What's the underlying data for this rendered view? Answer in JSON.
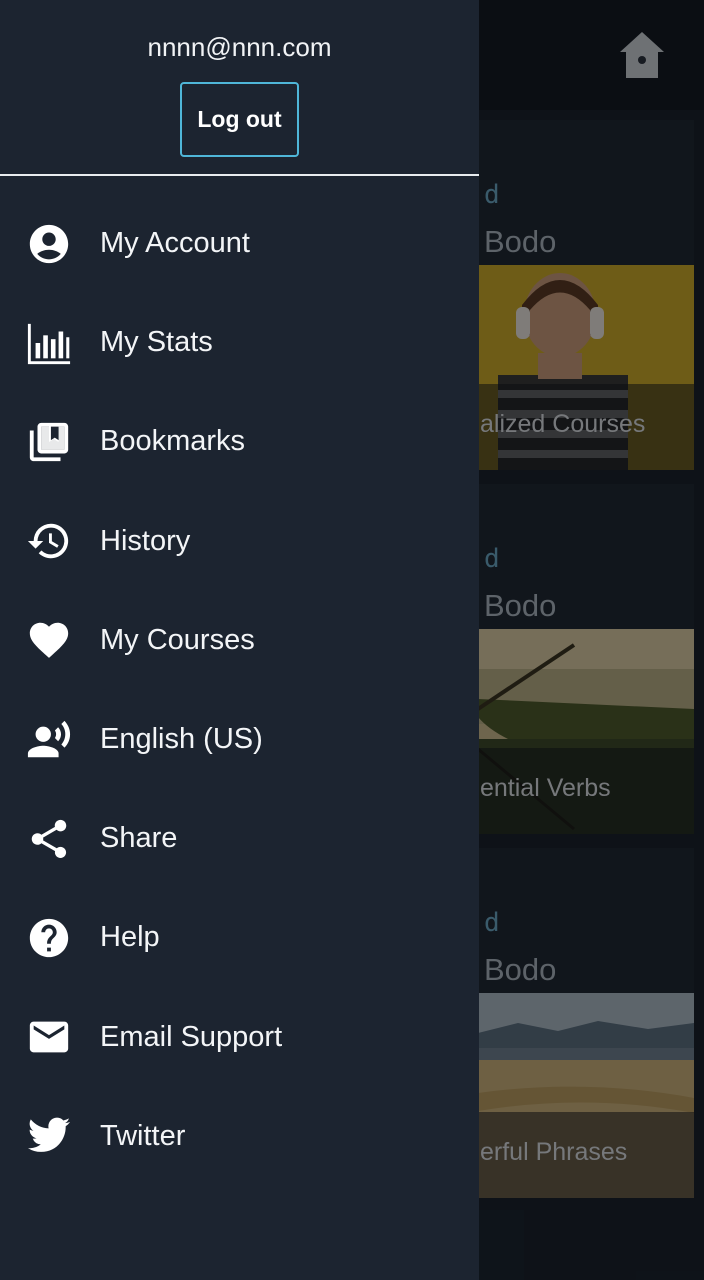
{
  "background": {
    "cards": [
      {
        "kicker": "d",
        "language": "Bodo",
        "caption": "alized Courses",
        "image": "woman-with-headphones"
      },
      {
        "kicker": "d",
        "language": "Bodo",
        "caption": "ential Verbs",
        "image": "boat-on-water"
      },
      {
        "kicker": "d",
        "language": "Bodo",
        "caption": "erful Phrases",
        "image": "desert-mountains"
      }
    ],
    "home_icon": "home-icon"
  },
  "drawer": {
    "email": "nnnn@nnn.com",
    "logout_label": "Log out",
    "items": [
      {
        "label": "My Account",
        "icon": "account-circle-icon"
      },
      {
        "label": "My Stats",
        "icon": "bar-chart-icon"
      },
      {
        "label": "Bookmarks",
        "icon": "bookmarks-icon"
      },
      {
        "label": "History",
        "icon": "history-icon"
      },
      {
        "label": "My Courses",
        "icon": "heart-icon"
      },
      {
        "label": "English (US)",
        "icon": "voice-language-icon"
      },
      {
        "label": "Share",
        "icon": "share-icon"
      },
      {
        "label": "Help",
        "icon": "help-icon"
      },
      {
        "label": "Email Support",
        "icon": "email-icon"
      },
      {
        "label": "Twitter",
        "icon": "twitter-icon"
      }
    ]
  },
  "colors": {
    "drawer_bg": "#1c2430",
    "accent": "#4fb6d8",
    "text": "#f3f5f7"
  }
}
